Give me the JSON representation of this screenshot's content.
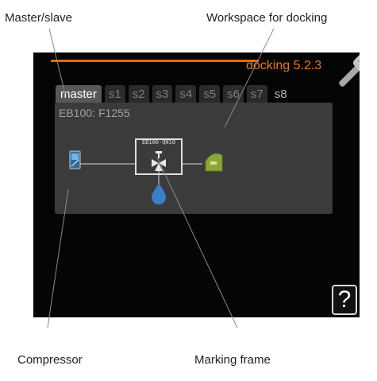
{
  "callouts": {
    "master_slave": "Master/slave",
    "workspace": "Workspace for docking",
    "compressor": "Compressor",
    "marking_frame": "Marking frame"
  },
  "screen": {
    "title": "docking 5.2.3",
    "tabs": [
      "master",
      "s1",
      "s2",
      "s3",
      "s4",
      "s5",
      "s6",
      "s7",
      "s8"
    ],
    "active_tab": "master",
    "panel": {
      "header_code": "EB100:",
      "header_model": "F1255",
      "valve_label": "EB100-QN10"
    },
    "help_label": "?"
  },
  "colors": {
    "accent": "#e67a1e",
    "screen_bg": "#050505",
    "panel_bg": "#3b3b3b",
    "marking_frame": "#e0e0e0",
    "water_drop": "#3a7fc8",
    "pool_icon": "#8aa83a"
  },
  "icons": [
    "wrench-icon",
    "compressor-icon",
    "valve-icon",
    "water-drop-icon",
    "pool-icon",
    "help-icon"
  ]
}
